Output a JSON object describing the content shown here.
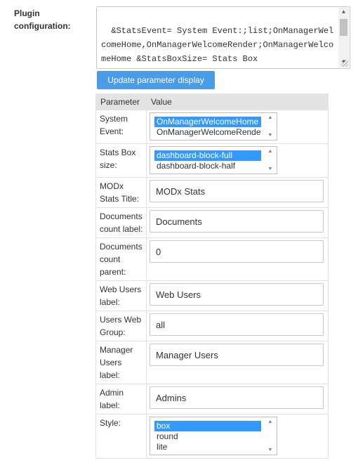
{
  "plugin": {
    "config_label": "Plugin configuration:",
    "config_text": "&StatsEvent= System Event:;list;OnManagerWelcomeHome,OnManagerWelcomeRender;OnManagerWelcomeHome &StatsBoxSize= Stats Box",
    "update_button": "Update parameter display"
  },
  "table": {
    "headers": {
      "parameter": "Parameter",
      "value": "Value"
    },
    "rows": [
      {
        "name": "System Event:",
        "type": "list",
        "options": [
          "OnManagerWelcomeHome",
          "OnManagerWelcomeRender"
        ],
        "selected": "OnManagerWelcomeHome"
      },
      {
        "name": "Stats Box size:",
        "type": "list",
        "options": [
          "dashboard-block-full",
          "dashboard-block-half"
        ],
        "selected": "dashboard-block-full"
      },
      {
        "name": "MODx Stats Title:",
        "type": "text",
        "value": "MODx Stats"
      },
      {
        "name": "Documents count label:",
        "type": "text",
        "value": "Documents"
      },
      {
        "name": "Documents count parent:",
        "type": "text",
        "value": "0"
      },
      {
        "name": "Web Users label:",
        "type": "text",
        "value": "Web Users"
      },
      {
        "name": "Users Web Group:",
        "type": "text",
        "value": "all"
      },
      {
        "name": "Manager Users label:",
        "type": "text",
        "value": "Manager Users"
      },
      {
        "name": "Admin label:",
        "type": "text",
        "value": "Admins"
      },
      {
        "name": "Style:",
        "type": "list",
        "options": [
          "box",
          "round",
          "lite"
        ],
        "selected": "box"
      }
    ]
  },
  "colors": {
    "accent": "#4a9be8",
    "selection": "#3399ff",
    "header_bg": "#e3e3e3"
  },
  "icons": {
    "scroll_up": "chevron-up-icon",
    "scroll_down": "chevron-down-icon"
  }
}
